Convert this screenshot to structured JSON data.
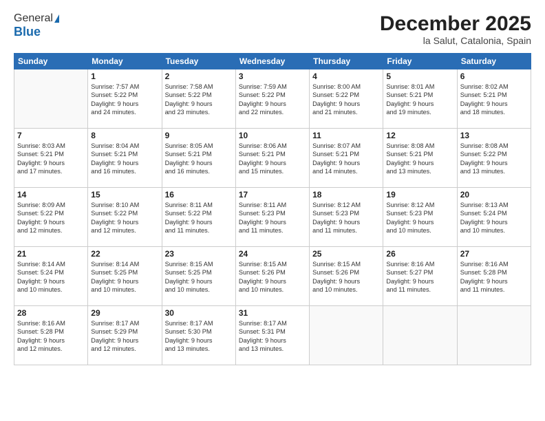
{
  "header": {
    "logo_line1": "General",
    "logo_line2": "Blue",
    "title": "December 2025",
    "subtitle": "la Salut, Catalonia, Spain"
  },
  "days_of_week": [
    "Sunday",
    "Monday",
    "Tuesday",
    "Wednesday",
    "Thursday",
    "Friday",
    "Saturday"
  ],
  "weeks": [
    [
      {
        "day": "",
        "info": ""
      },
      {
        "day": "1",
        "info": "Sunrise: 7:57 AM\nSunset: 5:22 PM\nDaylight: 9 hours\nand 24 minutes."
      },
      {
        "day": "2",
        "info": "Sunrise: 7:58 AM\nSunset: 5:22 PM\nDaylight: 9 hours\nand 23 minutes."
      },
      {
        "day": "3",
        "info": "Sunrise: 7:59 AM\nSunset: 5:22 PM\nDaylight: 9 hours\nand 22 minutes."
      },
      {
        "day": "4",
        "info": "Sunrise: 8:00 AM\nSunset: 5:22 PM\nDaylight: 9 hours\nand 21 minutes."
      },
      {
        "day": "5",
        "info": "Sunrise: 8:01 AM\nSunset: 5:21 PM\nDaylight: 9 hours\nand 19 minutes."
      },
      {
        "day": "6",
        "info": "Sunrise: 8:02 AM\nSunset: 5:21 PM\nDaylight: 9 hours\nand 18 minutes."
      }
    ],
    [
      {
        "day": "7",
        "info": "Sunrise: 8:03 AM\nSunset: 5:21 PM\nDaylight: 9 hours\nand 17 minutes."
      },
      {
        "day": "8",
        "info": "Sunrise: 8:04 AM\nSunset: 5:21 PM\nDaylight: 9 hours\nand 16 minutes."
      },
      {
        "day": "9",
        "info": "Sunrise: 8:05 AM\nSunset: 5:21 PM\nDaylight: 9 hours\nand 16 minutes."
      },
      {
        "day": "10",
        "info": "Sunrise: 8:06 AM\nSunset: 5:21 PM\nDaylight: 9 hours\nand 15 minutes."
      },
      {
        "day": "11",
        "info": "Sunrise: 8:07 AM\nSunset: 5:21 PM\nDaylight: 9 hours\nand 14 minutes."
      },
      {
        "day": "12",
        "info": "Sunrise: 8:08 AM\nSunset: 5:21 PM\nDaylight: 9 hours\nand 13 minutes."
      },
      {
        "day": "13",
        "info": "Sunrise: 8:08 AM\nSunset: 5:22 PM\nDaylight: 9 hours\nand 13 minutes."
      }
    ],
    [
      {
        "day": "14",
        "info": "Sunrise: 8:09 AM\nSunset: 5:22 PM\nDaylight: 9 hours\nand 12 minutes."
      },
      {
        "day": "15",
        "info": "Sunrise: 8:10 AM\nSunset: 5:22 PM\nDaylight: 9 hours\nand 12 minutes."
      },
      {
        "day": "16",
        "info": "Sunrise: 8:11 AM\nSunset: 5:22 PM\nDaylight: 9 hours\nand 11 minutes."
      },
      {
        "day": "17",
        "info": "Sunrise: 8:11 AM\nSunset: 5:23 PM\nDaylight: 9 hours\nand 11 minutes."
      },
      {
        "day": "18",
        "info": "Sunrise: 8:12 AM\nSunset: 5:23 PM\nDaylight: 9 hours\nand 11 minutes."
      },
      {
        "day": "19",
        "info": "Sunrise: 8:12 AM\nSunset: 5:23 PM\nDaylight: 9 hours\nand 10 minutes."
      },
      {
        "day": "20",
        "info": "Sunrise: 8:13 AM\nSunset: 5:24 PM\nDaylight: 9 hours\nand 10 minutes."
      }
    ],
    [
      {
        "day": "21",
        "info": "Sunrise: 8:14 AM\nSunset: 5:24 PM\nDaylight: 9 hours\nand 10 minutes."
      },
      {
        "day": "22",
        "info": "Sunrise: 8:14 AM\nSunset: 5:25 PM\nDaylight: 9 hours\nand 10 minutes."
      },
      {
        "day": "23",
        "info": "Sunrise: 8:15 AM\nSunset: 5:25 PM\nDaylight: 9 hours\nand 10 minutes."
      },
      {
        "day": "24",
        "info": "Sunrise: 8:15 AM\nSunset: 5:26 PM\nDaylight: 9 hours\nand 10 minutes."
      },
      {
        "day": "25",
        "info": "Sunrise: 8:15 AM\nSunset: 5:26 PM\nDaylight: 9 hours\nand 10 minutes."
      },
      {
        "day": "26",
        "info": "Sunrise: 8:16 AM\nSunset: 5:27 PM\nDaylight: 9 hours\nand 11 minutes."
      },
      {
        "day": "27",
        "info": "Sunrise: 8:16 AM\nSunset: 5:28 PM\nDaylight: 9 hours\nand 11 minutes."
      }
    ],
    [
      {
        "day": "28",
        "info": "Sunrise: 8:16 AM\nSunset: 5:28 PM\nDaylight: 9 hours\nand 12 minutes."
      },
      {
        "day": "29",
        "info": "Sunrise: 8:17 AM\nSunset: 5:29 PM\nDaylight: 9 hours\nand 12 minutes."
      },
      {
        "day": "30",
        "info": "Sunrise: 8:17 AM\nSunset: 5:30 PM\nDaylight: 9 hours\nand 13 minutes."
      },
      {
        "day": "31",
        "info": "Sunrise: 8:17 AM\nSunset: 5:31 PM\nDaylight: 9 hours\nand 13 minutes."
      },
      {
        "day": "",
        "info": ""
      },
      {
        "day": "",
        "info": ""
      },
      {
        "day": "",
        "info": ""
      }
    ]
  ]
}
